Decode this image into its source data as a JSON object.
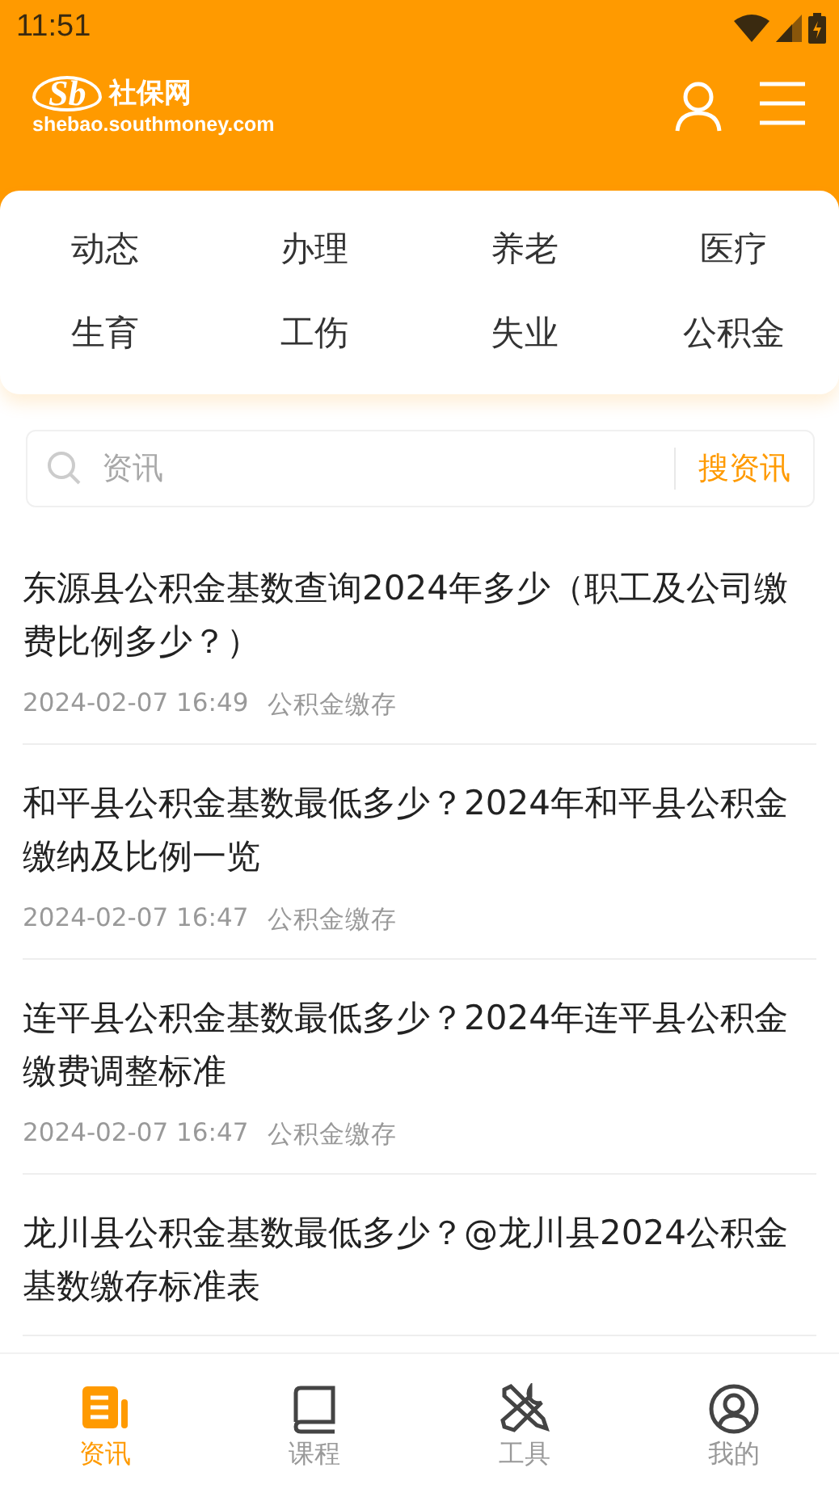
{
  "status_bar": {
    "time": "11:51"
  },
  "header": {
    "logo_mark": "Sb",
    "logo_name": "社保网",
    "logo_domain": "shebao.southmoney.com"
  },
  "categories": [
    {
      "label": "动态"
    },
    {
      "label": "办理"
    },
    {
      "label": "养老"
    },
    {
      "label": "医疗"
    },
    {
      "label": "生育"
    },
    {
      "label": "工伤"
    },
    {
      "label": "失业"
    },
    {
      "label": "公积金"
    }
  ],
  "search": {
    "placeholder": "资讯",
    "button": "搜资讯"
  },
  "articles": [
    {
      "title": "东源县公积金基数查询2024年多少（职工及公司缴费比例多少？）",
      "date": "2024-02-07 16:49",
      "tag": "公积金缴存"
    },
    {
      "title": "和平县公积金基数最低多少？2024年和平县公积金缴纳及比例一览",
      "date": "2024-02-07 16:47",
      "tag": "公积金缴存"
    },
    {
      "title": "连平县公积金基数最低多少？2024年连平县公积金缴费调整标准",
      "date": "2024-02-07 16:47",
      "tag": "公积金缴存"
    },
    {
      "title": "龙川县公积金基数最低多少？@龙川县2024公积金基数缴存标准表"
    }
  ],
  "tab_bar": [
    {
      "label": "资讯",
      "kind": "news",
      "selected": true
    },
    {
      "label": "课程",
      "kind": "book",
      "selected": false
    },
    {
      "label": "工具",
      "kind": "tools",
      "selected": false
    },
    {
      "label": "我的",
      "kind": "profile",
      "selected": false
    }
  ]
}
